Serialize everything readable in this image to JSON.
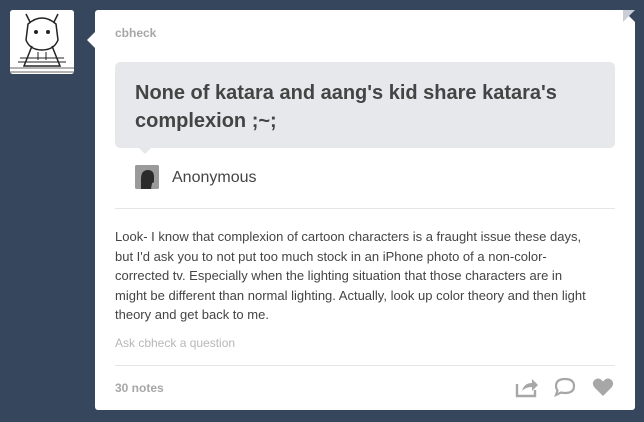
{
  "post": {
    "username": "cbheck",
    "question": "None of katara and aang's kid share katara's complexion ;~;",
    "asker": "Anonymous",
    "answer": "Look- I know that complexion of cartoon characters is a fraught issue these days, but I'd ask you to not put too much stock in an iPhone photo of a non-color-corrected tv. Especially when the lighting situation that those characters are in might be different than normal lighting. Actually, look up color theory and then light theory and get back to me.",
    "ask_link": "Ask cbheck a question",
    "notes": "30 notes"
  },
  "icons": {
    "share": "share-icon",
    "reply": "reply-icon",
    "like": "heart-icon"
  },
  "colors": {
    "background": "#36465d",
    "card": "#ffffff",
    "question_bubble": "#e6e8eb",
    "icon": "#a7a7a7"
  }
}
